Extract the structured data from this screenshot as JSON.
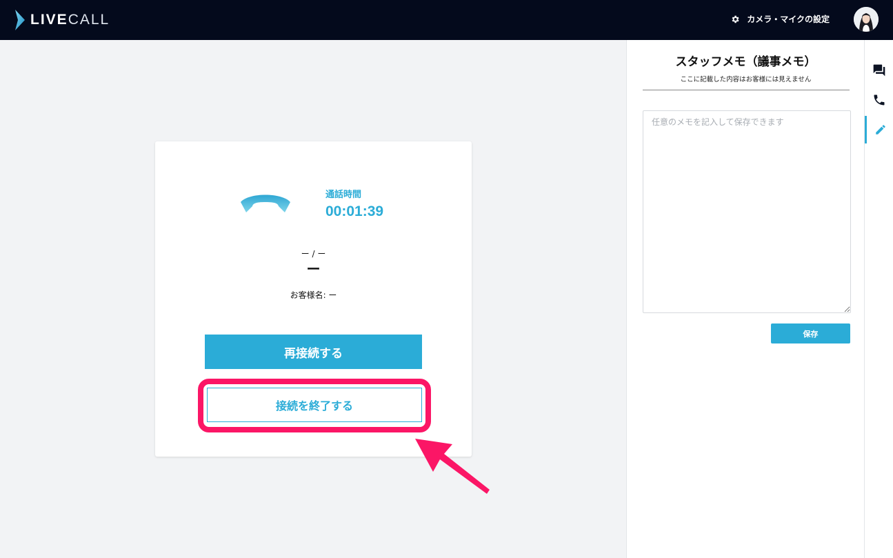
{
  "header": {
    "logo_live": "LIVE",
    "logo_call": "CALL",
    "settings_label": "カメラ・マイクの設定",
    "settings_icon": "gear-icon",
    "avatar_icon": "user-avatar"
  },
  "call": {
    "duration_label": "通話時間",
    "duration_value": "00:01:39",
    "pair_text": "ー / ー",
    "id_text": "ー",
    "customer_text": "お客様名: ー",
    "reconnect_label": "再接続する",
    "end_label": "接続を終了する",
    "phone_icon": "hangup-phone-icon"
  },
  "memo": {
    "title": "スタッフメモ（議事メモ）",
    "subtitle": "ここに記載した内容はお客様には見えません",
    "placeholder": "任意のメモを記入して保存できます",
    "value": "",
    "save_label": "保存"
  },
  "rail": {
    "items": [
      {
        "icon": "chat-icon",
        "active": false
      },
      {
        "icon": "phone-icon",
        "active": false
      },
      {
        "icon": "pencil-icon",
        "active": true
      }
    ]
  },
  "colors": {
    "accent": "#2bacd7",
    "header_bg": "#040a1c",
    "highlight": "#fb1666",
    "background": "#f2f3f5"
  }
}
